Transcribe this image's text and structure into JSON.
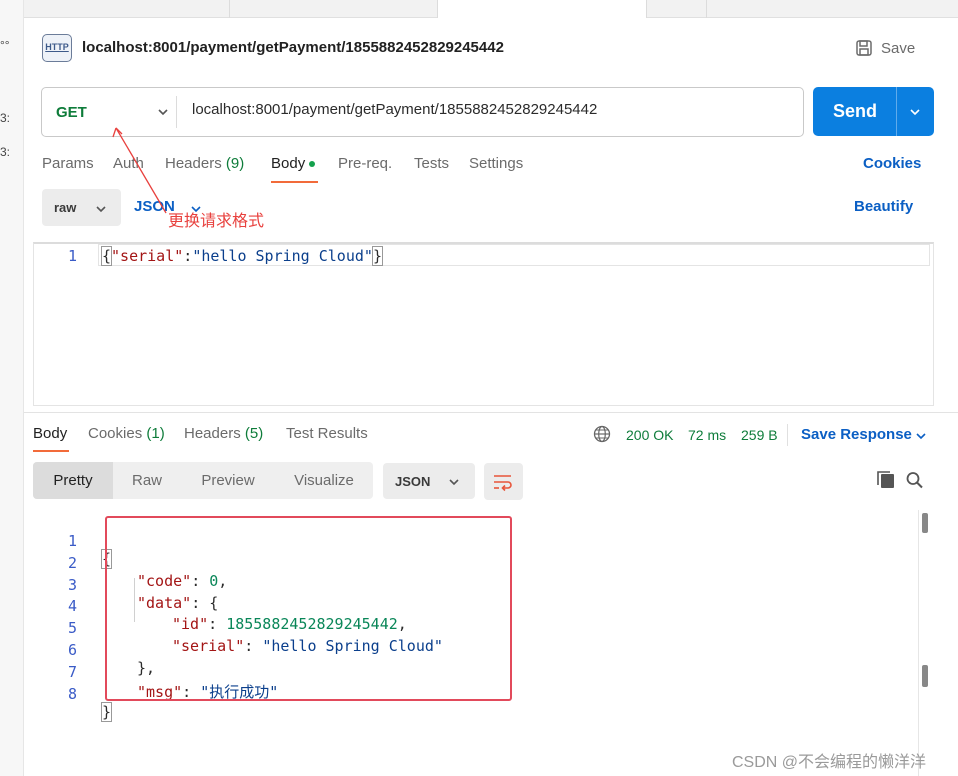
{
  "request": {
    "title": "localhost:8001/payment/getPayment/1855882452829245442",
    "http_badge": "HTTP",
    "save_label": "Save",
    "method": "GET",
    "url": "localhost:8001/payment/getPayment/1855882452829245442",
    "send_label": "Send"
  },
  "request_tabs": {
    "params": "Params",
    "auth": "Auth",
    "headers": "Headers",
    "headers_count": "(9)",
    "body": "Body",
    "prereq": "Pre-req.",
    "tests": "Tests",
    "settings": "Settings",
    "cookies": "Cookies"
  },
  "body_options": {
    "mode": "raw",
    "format": "JSON",
    "beautify": "Beautify"
  },
  "annotation": "更换请求格式",
  "request_editor": {
    "line_number": "1",
    "brace_open": "{",
    "key": "\"serial\"",
    "colon": ":",
    "value": "\"hello Spring Cloud\"",
    "brace_close": "}"
  },
  "response_tabs": {
    "body": "Body",
    "cookies": "Cookies",
    "cookies_count": "(1)",
    "headers": "Headers",
    "headers_count": "(5)",
    "test_results": "Test Results"
  },
  "response_status": {
    "status": "200 OK",
    "time": "72 ms",
    "size": "259 B",
    "save_response": "Save Response"
  },
  "view_modes": {
    "pretty": "Pretty",
    "raw": "Raw",
    "preview": "Preview",
    "visualize": "Visualize",
    "format": "JSON"
  },
  "response_lines": {
    "l1": {
      "n": "1",
      "brace": "{"
    },
    "l2": {
      "n": "2",
      "key": "\"code\"",
      "sep": ": ",
      "num": "0",
      "tail": ","
    },
    "l3": {
      "n": "3",
      "key": "\"data\"",
      "sep": ": ",
      "tail": "{"
    },
    "l4": {
      "n": "4",
      "key": "\"id\"",
      "sep": ": ",
      "num": "1855882452829245442",
      "tail": ","
    },
    "l5": {
      "n": "5",
      "key": "\"serial\"",
      "sep": ": ",
      "str": "\"hello Spring Cloud\""
    },
    "l6": {
      "n": "6",
      "tail": "},"
    },
    "l7": {
      "n": "7",
      "key": "\"msg\"",
      "sep": ": ",
      "str": "\"执行成功\""
    },
    "l8": {
      "n": "8",
      "brace": "}"
    }
  },
  "left_strip": {
    "t1": "°°",
    "t2": "3:",
    "t3": "3:"
  },
  "watermark": "CSDN @不会编程的懒洋洋",
  "colors": {
    "send_blue": "#0b7fe0",
    "method_green": "#0e7c3a",
    "link_blue": "#0b5fc4",
    "active_tab_underline": "#f26b3a",
    "annotation_red": "#e8413e",
    "result_box_red": "#e24a5b"
  }
}
